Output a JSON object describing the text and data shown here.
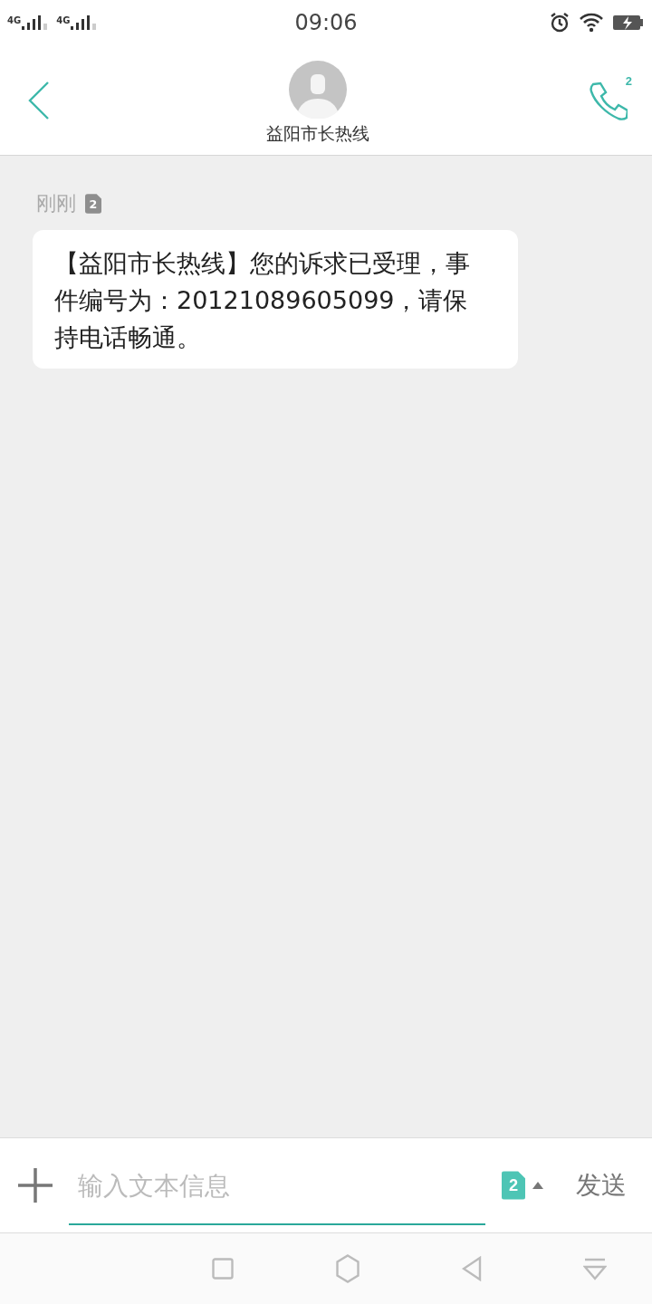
{
  "status_bar": {
    "sims": [
      {
        "network": "4G"
      },
      {
        "network": "4G"
      }
    ],
    "time": "09:06"
  },
  "header": {
    "contact": "益阳市长热线",
    "call_sim": "2"
  },
  "messages": [
    {
      "time": "刚刚",
      "sim": "2",
      "text": "【益阳市长热线】您的诉求已受理，事件编号为：20121089605099，请保持电话畅通。"
    }
  ],
  "composer": {
    "placeholder": "输入文本信息",
    "sim": "2",
    "send": "发送"
  }
}
